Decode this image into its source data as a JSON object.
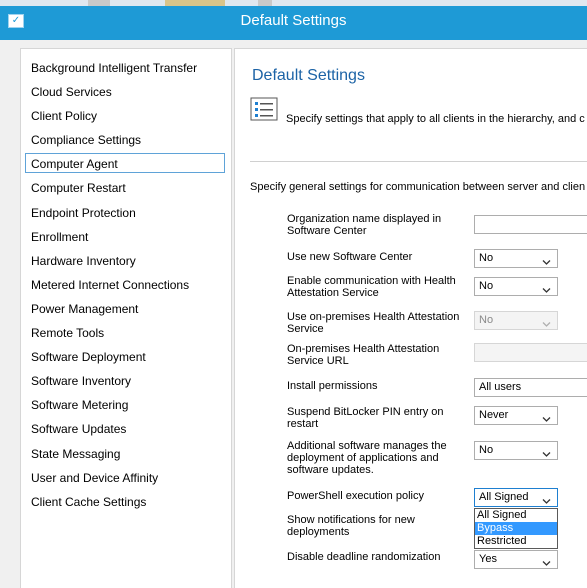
{
  "window": {
    "title": "Default Settings"
  },
  "nav": {
    "items": [
      {
        "label": "Background Intelligent Transfer"
      },
      {
        "label": "Cloud Services"
      },
      {
        "label": "Client Policy"
      },
      {
        "label": "Compliance Settings"
      },
      {
        "label": "Computer Agent",
        "selected": true
      },
      {
        "label": "Computer Restart"
      },
      {
        "label": "Endpoint Protection"
      },
      {
        "label": "Enrollment"
      },
      {
        "label": "Hardware Inventory"
      },
      {
        "label": "Metered Internet Connections"
      },
      {
        "label": "Power Management"
      },
      {
        "label": "Remote Tools"
      },
      {
        "label": "Software Deployment"
      },
      {
        "label": "Software Inventory"
      },
      {
        "label": "Software Metering"
      },
      {
        "label": "Software Updates"
      },
      {
        "label": "State Messaging"
      },
      {
        "label": "User and Device Affinity"
      },
      {
        "label": "Client Cache Settings"
      }
    ]
  },
  "main": {
    "heading": "Default Settings",
    "description": "Specify settings that apply to all clients in the hierarchy, and c",
    "section_description": "Specify general settings for communication between server and clien",
    "settings": [
      {
        "label": "Organization name displayed in Software Center",
        "value": "",
        "control": "text"
      },
      {
        "label": "Use new Software Center",
        "value": "No",
        "control": "dropdown"
      },
      {
        "label": "Enable communication with Health Attestation Service",
        "value": "No",
        "control": "dropdown"
      },
      {
        "label": "Use on-premises Health Attestation Service",
        "value": "No",
        "control": "dropdown-disabled"
      },
      {
        "label": "On-premises Health Attestation Service URL",
        "value": "",
        "control": "text-disabled"
      },
      {
        "label": "Install permissions",
        "value": "All users",
        "control": "text"
      },
      {
        "label": "Suspend BitLocker PIN entry on restart",
        "value": "Never",
        "control": "dropdown"
      },
      {
        "label": "Additional software manages the deployment of applications and software updates.",
        "value": "No",
        "control": "dropdown"
      },
      {
        "label": "PowerShell execution policy",
        "value": "All Signed",
        "control": "dropdown-open"
      },
      {
        "label": "Show notifications for new deployments",
        "value": "",
        "control": "none"
      },
      {
        "label": "Disable deadline randomization",
        "value": "Yes",
        "control": "dropdown"
      }
    ],
    "powershell_options": [
      "All Signed",
      "Bypass",
      "Restricted"
    ],
    "powershell_highlighted": "Bypass"
  },
  "colors": {
    "titlebar": "#1e9ad6",
    "heading": "#1c63a6",
    "selection_border": "#5fa3d8",
    "highlight": "#3399ff"
  }
}
